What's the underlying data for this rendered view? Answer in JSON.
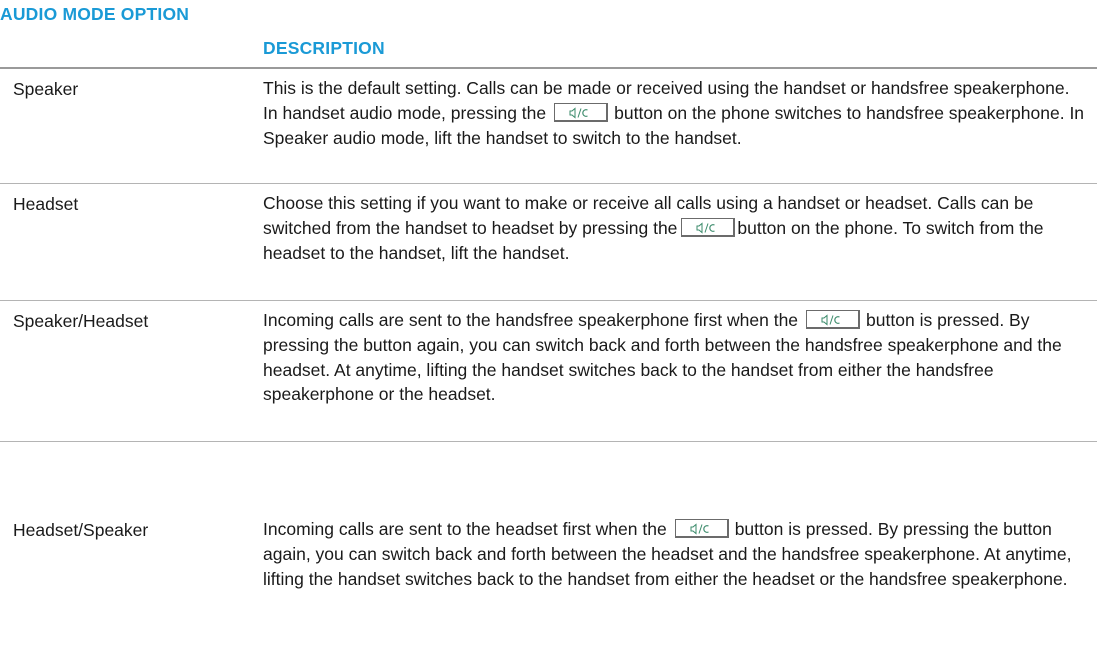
{
  "header": {
    "col_option": "AUDIO MODE OPTION",
    "col_description": "DESCRIPTION"
  },
  "icons": {
    "speaker_button": "speaker-button-icon"
  },
  "rows": [
    {
      "option": "Speaker",
      "desc": [
        "This is the default setting. Calls can be made or received using the handset or handsfree speakerphone. In handset audio mode, pressing the",
        "button on the phone switches to handsfree speakerphone. In Speaker audio mode, lift the handset to switch to the handset."
      ]
    },
    {
      "option": "Headset",
      "desc": [
        "Choose this setting if you want to make or receive all calls using a handset or headset. Calls can be switched from the handset to headset by pressing the",
        "button on the phone. To switch from the headset to the handset, lift the handset."
      ]
    },
    {
      "option": "Speaker/Headset",
      "desc": [
        "Incoming calls are sent to the handsfree speakerphone first when the",
        "button is pressed. By pressing the button again, you can switch back and forth between the handsfree speakerphone and the headset. At anytime, lifting the handset switches back to the handset from either the handsfree speakerphone or the headset."
      ]
    },
    {
      "option": "Headset/Speaker",
      "desc": [
        "Incoming calls are sent to the headset first when the",
        "button is pressed. By pressing the button again, you can switch back and forth between the headset and the handsfree speakerphone. At anytime, lifting the handset switches back to the handset from either the headset or the handsfree speakerphone."
      ]
    }
  ]
}
